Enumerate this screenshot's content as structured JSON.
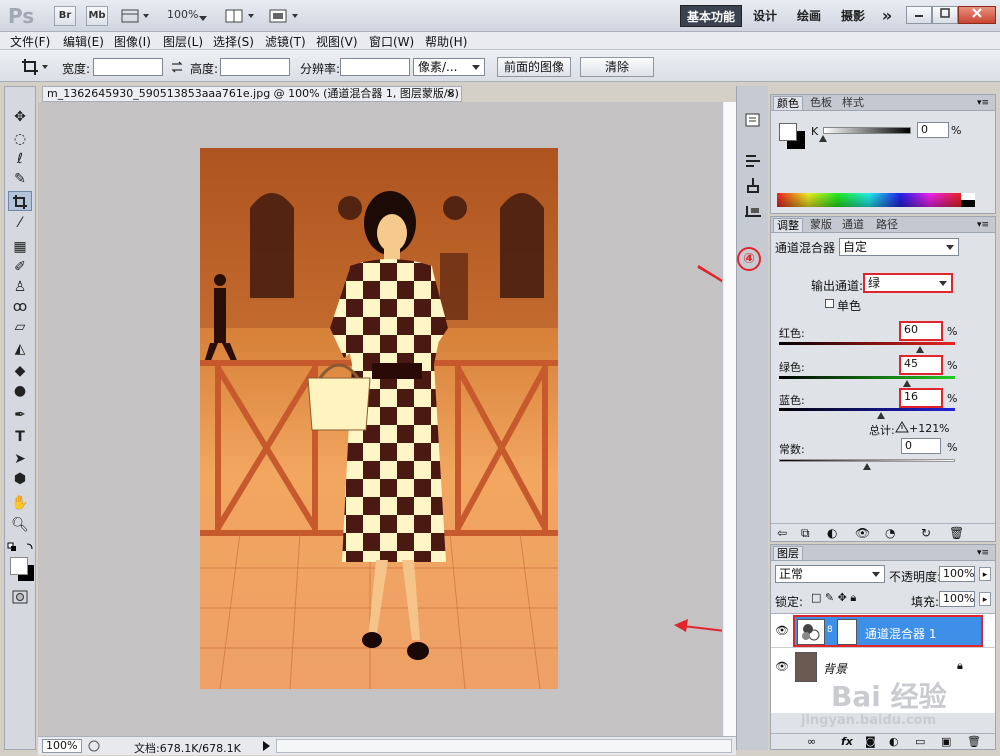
{
  "titlebar": {
    "logo": "Ps",
    "br": "Br",
    "mb": "Mb",
    "zoom": "100%",
    "workspaces": [
      "基本功能",
      "设计",
      "绘画",
      "摄影"
    ],
    "more": "»"
  },
  "menu": [
    "文件(F)",
    "编辑(E)",
    "图像(I)",
    "图层(L)",
    "选择(S)",
    "滤镜(T)",
    "视图(V)",
    "窗口(W)",
    "帮助(H)"
  ],
  "options": {
    "width_label": "宽度:",
    "height_label": "高度:",
    "resolution_label": "分辨率:",
    "unit": "像素/...",
    "front_image": "前面的图像",
    "clear": "清除"
  },
  "document": {
    "tab_title": "m_1362645930_590513853aaa761e.jpg @ 100% (通道混合器 1, 图层蒙版/8) *",
    "tab_close": "×"
  },
  "status": {
    "zoom": "100%",
    "doc_size": "文档:678.1K/678.1K"
  },
  "color_panel": {
    "tabs": [
      "颜色",
      "色板",
      "样式"
    ],
    "k_label": "K",
    "k_value": "0",
    "unit": "%"
  },
  "adjust_panel": {
    "tabs": [
      "调整",
      "蒙版",
      "通道",
      "路径"
    ],
    "name": "通道混合器",
    "preset": "自定",
    "output_label": "输出通道:",
    "output_value": "绿",
    "mono_label": "单色",
    "red_label": "红色:",
    "red_value": "60",
    "green_label": "绿色:",
    "green_value": "45",
    "blue_label": "蓝色:",
    "blue_value": "16",
    "total_label": "总计:",
    "total_value": "+121",
    "constant_label": "常数:",
    "constant_value": "0",
    "pct": "%",
    "annotation_number": "④",
    "red_level": 0.8,
    "green_level": 0.725,
    "blue_level": 0.58,
    "constant_level": 0.5
  },
  "layers_panel": {
    "tab": "图层",
    "blend": "正常",
    "opacity_label": "不透明度:",
    "opacity_value": "100%",
    "lock_label": "锁定:",
    "fill_label": "填充:",
    "fill_value": "100%",
    "layers": [
      {
        "name": "通道混合器 1",
        "selected": true
      },
      {
        "name": "背景",
        "selected": false
      }
    ]
  },
  "watermark": {
    "line1": "Bai 经验",
    "line2": "jingyan.baidu.com"
  },
  "colors": {
    "accent_red": "#e0252b",
    "layer_selected": "#3d8fe8",
    "photo_tint": "#e8953f"
  }
}
